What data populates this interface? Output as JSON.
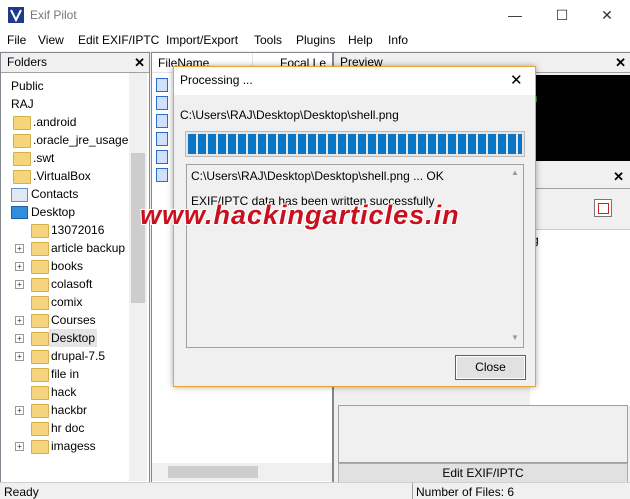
{
  "window": {
    "title": "Exif Pilot",
    "minimize": "—",
    "maximize": "☐",
    "close": "✕"
  },
  "menu": [
    "File",
    "View",
    "Edit EXIF/IPTC",
    "Import/Export",
    "Tools",
    "Plugins",
    "Help",
    "Info"
  ],
  "folders_panel": {
    "title": "Folders",
    "close": "✕",
    "items": [
      {
        "label": "Public",
        "icon": "none"
      },
      {
        "label": "RAJ",
        "icon": "none"
      },
      {
        "label": ".android",
        "icon": "folder-icon"
      },
      {
        "label": ".oracle_jre_usage",
        "icon": "folder-icon"
      },
      {
        "label": ".swt",
        "icon": "folder-icon"
      },
      {
        "label": ".VirtualBox",
        "icon": "folder-icon"
      },
      {
        "label": "Contacts",
        "icon": "contacts-icon"
      },
      {
        "label": "Desktop",
        "icon": "desktop-icon"
      },
      {
        "label": "13072016",
        "icon": "folder-icon"
      },
      {
        "label": "article backup",
        "icon": "folder-icon"
      },
      {
        "label": "books",
        "icon": "folder-icon"
      },
      {
        "label": "colasoft",
        "icon": "folder-icon"
      },
      {
        "label": "comix",
        "icon": "folder-icon"
      },
      {
        "label": "Courses",
        "icon": "folder-icon"
      },
      {
        "label": "Desktop",
        "icon": "folder-icon"
      },
      {
        "label": "drupal-7.5",
        "icon": "folder-icon"
      },
      {
        "label": "file in",
        "icon": "folder-icon"
      },
      {
        "label": "hack",
        "icon": "folder-icon"
      },
      {
        "label": "hackbr",
        "icon": "folder-icon"
      },
      {
        "label": "hr doc",
        "icon": "folder-icon"
      },
      {
        "label": "imagess",
        "icon": "folder-icon"
      }
    ]
  },
  "files_panel": {
    "col_filename": "FileName",
    "col_focal": "Focal Le"
  },
  "preview_panel": {
    "title": "Preview",
    "close": "✕",
    "edit_button": "Edit EXIF/IPTC",
    "partial_col": "g"
  },
  "status": {
    "left": "Ready",
    "right": "Number of Files: 6"
  },
  "dialog": {
    "title": "Processing ...",
    "close": "✕",
    "path": "C:\\Users\\RAJ\\Desktop\\Desktop\\shell.png",
    "progress": 1.0,
    "log_line1": "C:\\Users\\RAJ\\Desktop\\Desktop\\shell.png ... OK",
    "log_line2": "EXIF/IPTC data has been written successfully",
    "close_button": "Close"
  },
  "watermark": "www.hackingarticles.in",
  "colors": {
    "accent": "#0078d7",
    "progress": "#0a75c7",
    "dialog_border": "#e5a530",
    "watermark": "#c8101e"
  }
}
